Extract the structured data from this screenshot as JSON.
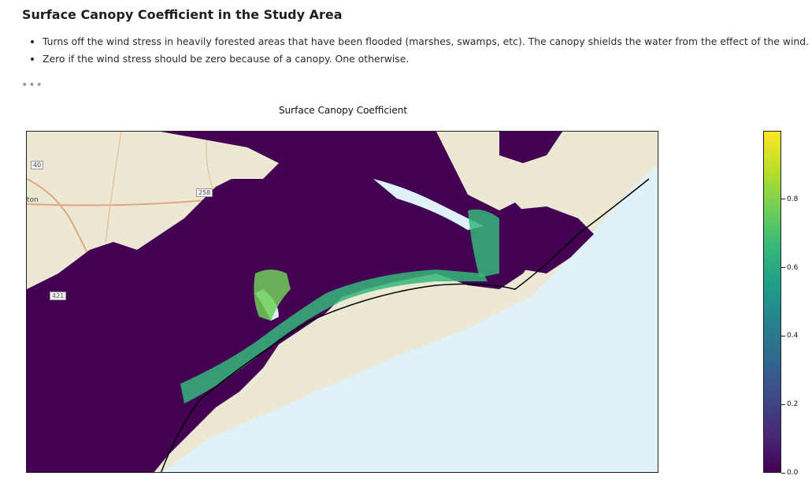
{
  "heading": "Surface Canopy Coefficient in the Study Area",
  "bullets": [
    "Turns off the wind stress in heavily forested areas that have been flooded (marshes, swamps, etc). The canopy shields the water from the effect of the wind.",
    "Zero if the wind stress should be zero because of a canopy. One otherwise."
  ],
  "ellipsis": "•••",
  "map_labels": {
    "highway_40": "40",
    "highway_258": "258",
    "highway_421": "421",
    "town_fragment": "ton"
  },
  "chart_data": {
    "type": "heatmap",
    "title": "Surface Canopy Coefficient",
    "xlabel": "",
    "ylabel": "",
    "colormap": "viridis",
    "colorbar": {
      "range": [
        0.0,
        1.0
      ],
      "ticks": [
        0.0,
        0.2,
        0.4,
        0.6,
        0.8
      ],
      "tick_labels": [
        "0.0",
        "0.2",
        "0.4",
        "0.6",
        "0.8"
      ]
    },
    "colors": {
      "low": "#440154",
      "high": "#fde725",
      "water": "#dff2fa",
      "land": "#ece8d4"
    }
  }
}
